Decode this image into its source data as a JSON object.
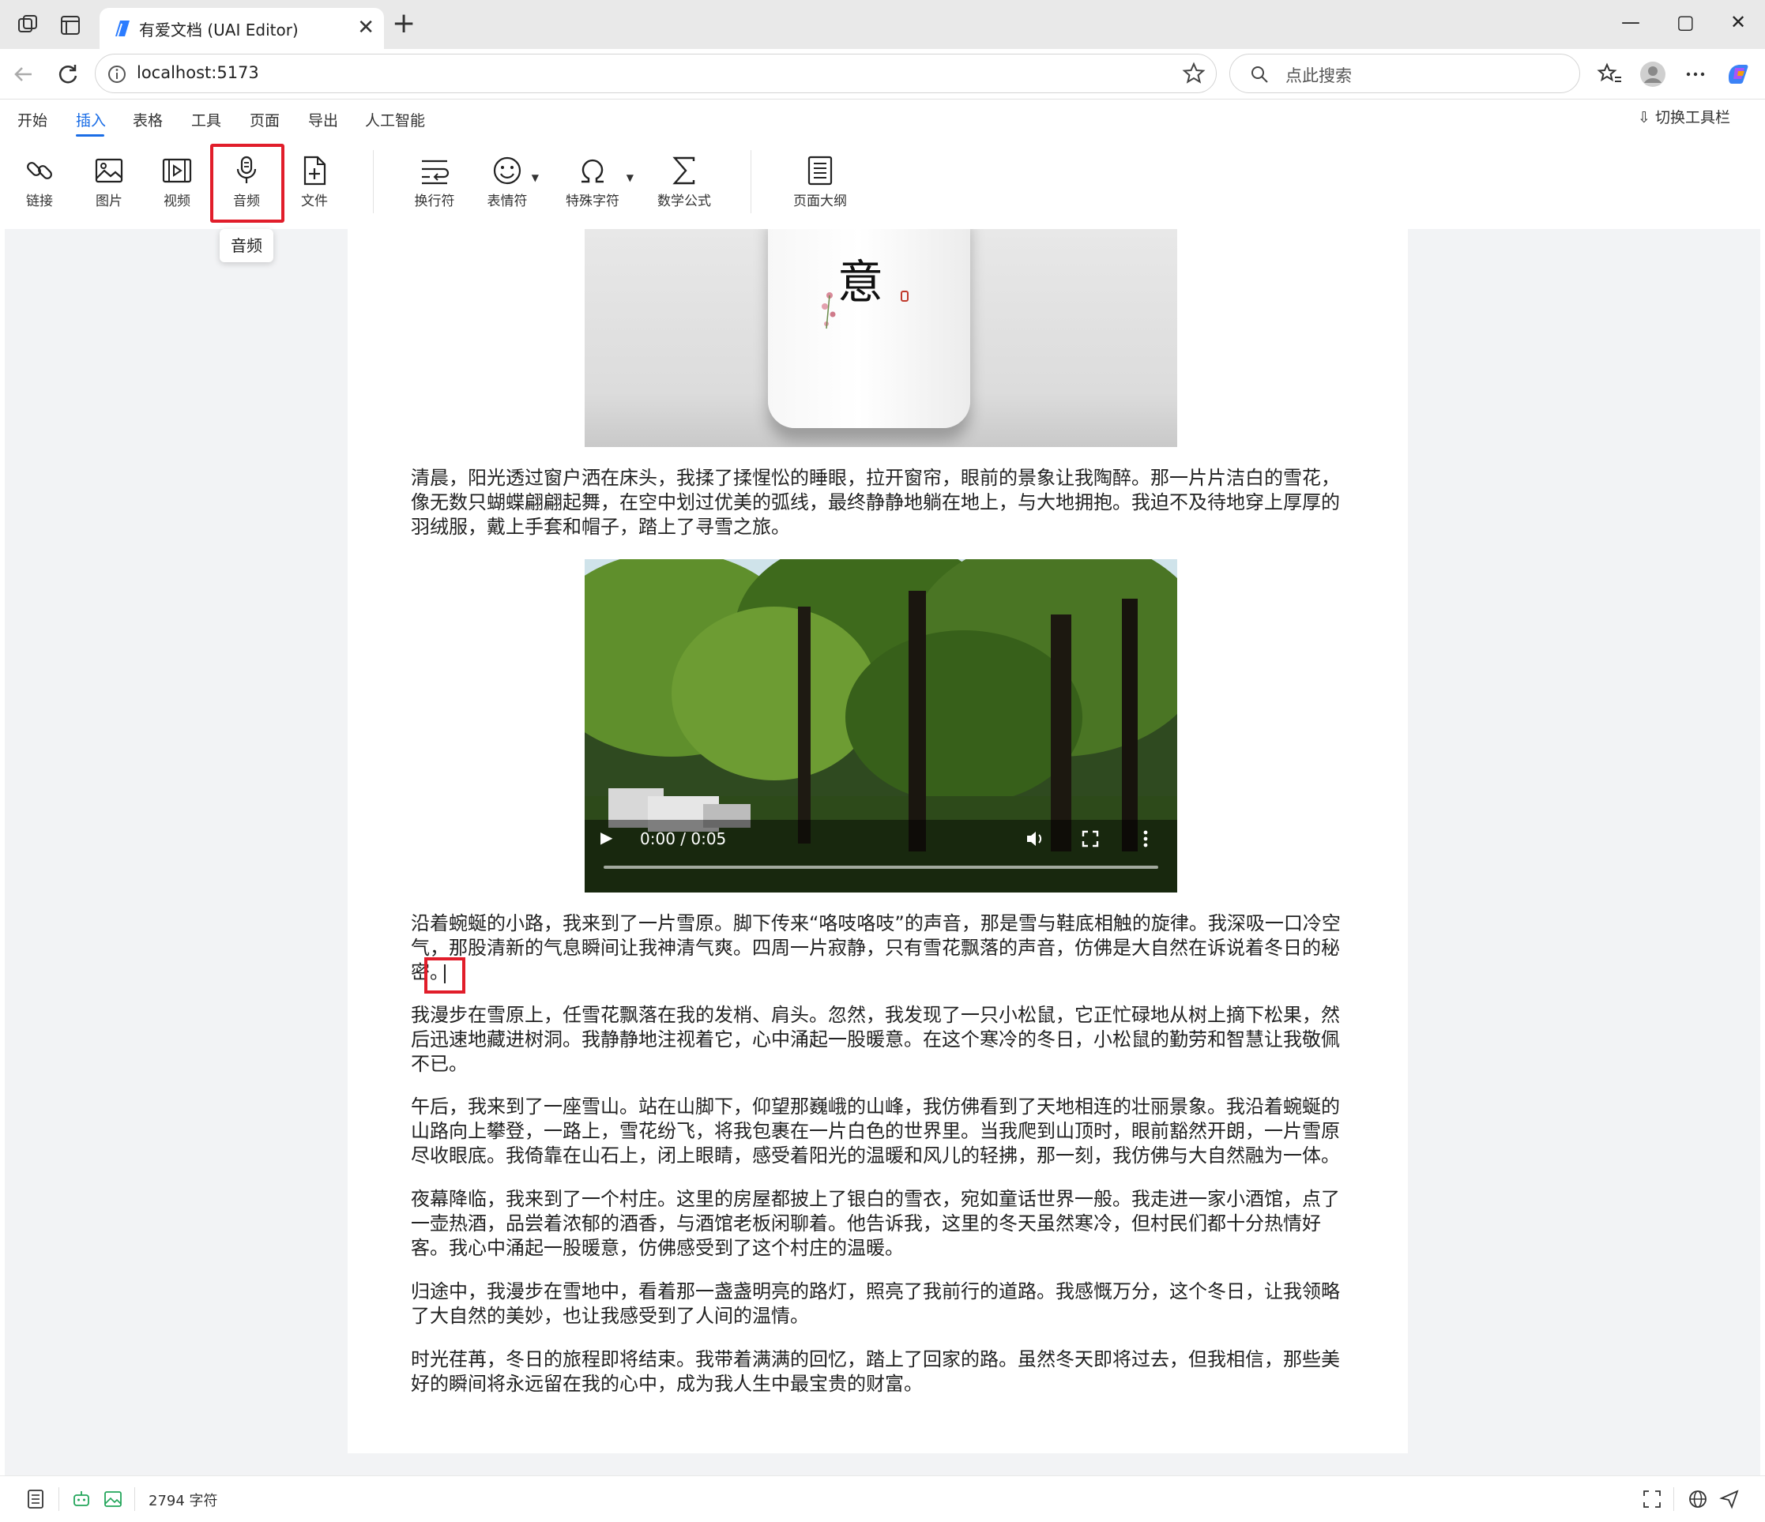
{
  "browser": {
    "tab_title": "有爱文档 (UAI Editor)",
    "close_symbol": "✕",
    "new_tab_symbol": "+",
    "window_controls": {
      "minimize": "—",
      "maximize": "▢",
      "close": "✕"
    },
    "url": "localhost:5173",
    "search_placeholder": "点此搜索"
  },
  "menu": {
    "items": [
      "开始",
      "插入",
      "表格",
      "工具",
      "页面",
      "导出",
      "人工智能"
    ],
    "active": "插入",
    "switch_toolbar": "切换工具栏",
    "accent_color": "#1a6de6"
  },
  "ribbon": {
    "buttons": [
      {
        "label": "链接",
        "icon": "link-icon"
      },
      {
        "label": "图片",
        "icon": "image-icon"
      },
      {
        "label": "视频",
        "icon": "video-icon"
      },
      {
        "label": "音频",
        "icon": "microphone-icon"
      },
      {
        "label": "文件",
        "icon": "file-add-icon"
      },
      {
        "label": "换行符",
        "icon": "line-break-icon"
      },
      {
        "label": "表情符",
        "icon": "emoji-icon"
      },
      {
        "label": "特殊字符",
        "icon": "omega-icon"
      },
      {
        "label": "数学公式",
        "icon": "sigma-icon"
      },
      {
        "label": "页面大纲",
        "icon": "outline-icon"
      }
    ],
    "tooltip": "音频",
    "highlight_color": "#e11d2a"
  },
  "document": {
    "image_calligraphy": "意",
    "video": {
      "time": "0:00 / 0:05"
    },
    "paragraphs": [
      "清晨，阳光透过窗户洒在床头，我揉了揉惺忪的睡眼，拉开窗帘，眼前的景象让我陶醉。那一片片洁白的雪花，像无数只蝴蝶翩翩起舞，在空中划过优美的弧线，最终静静地躺在地上，与大地拥抱。我迫不及待地穿上厚厚的羽绒服，戴上手套和帽子，踏上了寻雪之旅。",
      "沿着蜿蜒的小路，我来到了一片雪原。脚下传来“咯吱咯吱”的声音，那是雪与鞋底相触的旋律。我深吸一口冷空气，那股清新的气息瞬间让我神清气爽。四周一片寂静，只有雪花飘落的声音，仿佛是大自然在诉说着冬日的秘密。",
      "我漫步在雪原上，任雪花飘落在我的发梢、肩头。忽然，我发现了一只小松鼠，它正忙碌地从树上摘下松果，然后迅速地藏进树洞。我静静地注视着它，心中涌起一股暖意。在这个寒冷的冬日，小松鼠的勤劳和智慧让我敬佩不已。",
      "午后，我来到了一座雪山。站在山脚下，仰望那巍峨的山峰，我仿佛看到了天地相连的壮丽景象。我沿着蜿蜒的山路向上攀登，一路上，雪花纷飞，将我包裹在一片白色的世界里。当我爬到山顶时，眼前豁然开朗，一片雪原尽收眼底。我倚靠在山石上，闭上眼睛，感受着阳光的温暖和风儿的轻拂，那一刻，我仿佛与大自然融为一体。",
      "夜幕降临，我来到了一个村庄。这里的房屋都披上了银白的雪衣，宛如童话世界一般。我走进一家小酒馆，点了一壶热酒，品尝着浓郁的酒香，与酒馆老板闲聊着。他告诉我，这里的冬天虽然寒冷，但村民们都十分热情好客。我心中涌起一股暖意，仿佛感受到了这个村庄的温暖。",
      "归途中，我漫步在雪地中，看着那一盏盏明亮的路灯，照亮了我前行的道路。我感慨万分，这个冬日，让我领略了大自然的美妙，也让我感受到了人间的温情。",
      "时光荏苒，冬日的旅程即将结束。我带着满满的回忆，踏上了回家的路。虽然冬天即将过去，但我相信，那些美好的瞬间将永远留在我的心中，成为我人生中最宝贵的财富。"
    ]
  },
  "status": {
    "char_count": "2794 字符"
  }
}
